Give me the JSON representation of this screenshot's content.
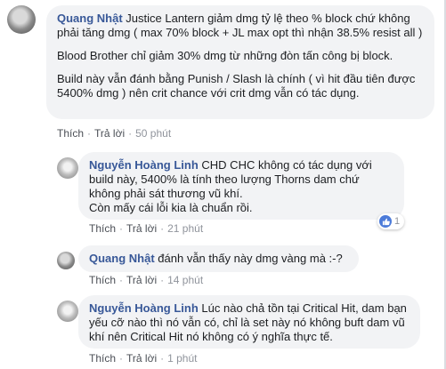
{
  "comments": [
    {
      "author": "Quang Nhật",
      "paragraphs": [
        "Justice Lantern giảm dmg tỷ lệ theo % block chứ không phải tăng dmg ( max 70% block + JL max opt thì nhận 38.5% resist all )",
        "Blood Brother chỉ giảm 30% dmg từ những đòn tấn công bị block.",
        "Build này vẫn đánh bằng Punish / Slash là chính ( vì hit đầu tiên được 5400% dmg ) nên crit chance với crit dmg vẫn có tác dụng."
      ],
      "actions": {
        "like": "Thích",
        "reply": "Trả lời",
        "time": "50 phút"
      }
    },
    {
      "author": "Nguyễn Hoàng Linh",
      "paragraphs": [
        "CHD CHC không có tác dụng với build này, 5400% là tính theo lượng Thorns dam chứ không phải sát thương vũ khí.",
        "Còn mấy cái lỗi kia là chuẩn rồi."
      ],
      "reaction_count": "1",
      "actions": {
        "like": "Thích",
        "reply": "Trả lời",
        "time": "21 phút"
      }
    },
    {
      "author": "Quang Nhật",
      "paragraphs": [
        "đánh vẫn thấy này dmg vàng mà :-?"
      ],
      "actions": {
        "like": "Thích",
        "reply": "Trả lời",
        "time": "14 phút"
      }
    },
    {
      "author": "Nguyễn Hoàng Linh",
      "paragraphs": [
        "Lúc nào chả tồn tại Critical Hit, dam bạn yếu cỡ nào thì nó vẫn có, chỉ là set này nó không buft dam vũ khí nên Critical Hit nó không có ý nghĩa thực tế."
      ],
      "actions": {
        "like": "Thích",
        "reply": "Trả lời",
        "time": "1 phút"
      }
    }
  ]
}
